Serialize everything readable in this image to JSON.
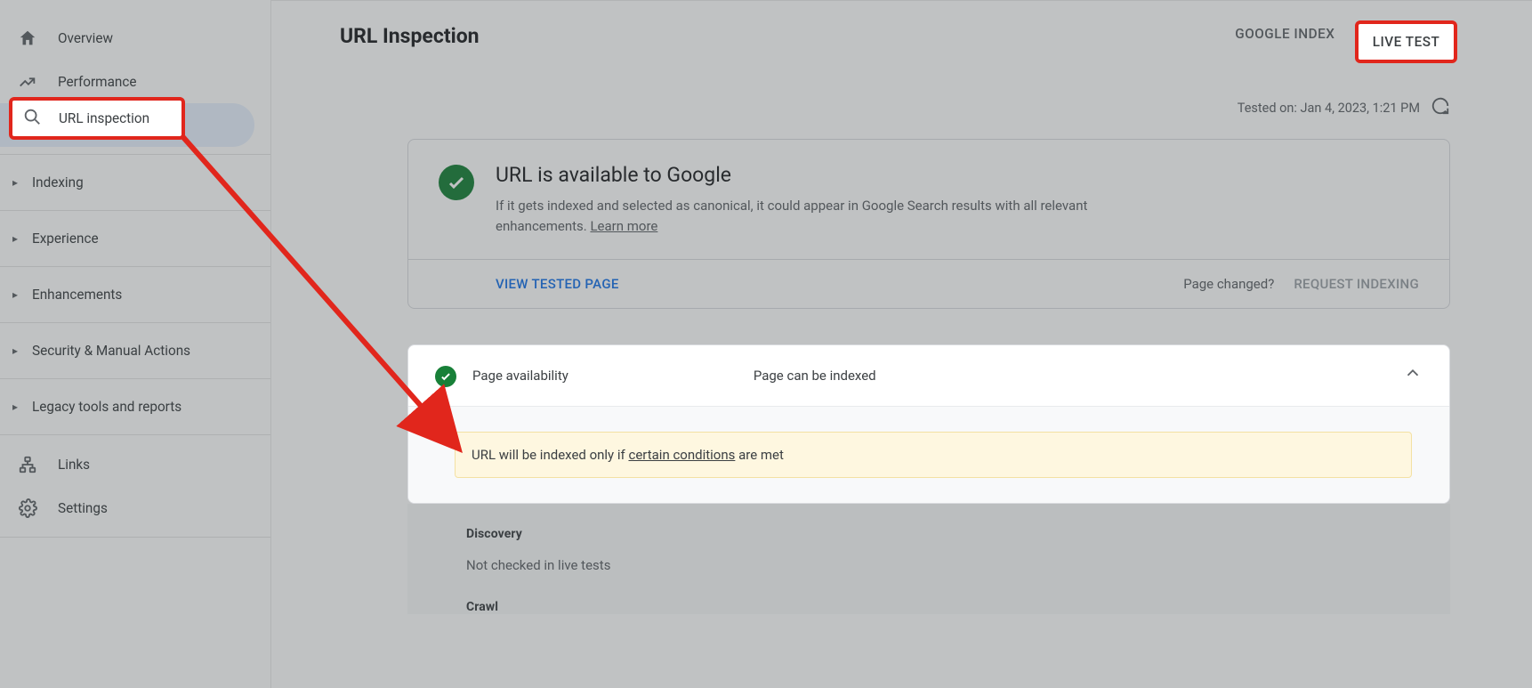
{
  "sidebar": {
    "overview": "Overview",
    "performance": "Performance",
    "url_inspection": "URL inspection",
    "indexing": "Indexing",
    "experience": "Experience",
    "enhancements": "Enhancements",
    "security": "Security & Manual Actions",
    "legacy": "Legacy tools and reports",
    "links": "Links",
    "settings": "Settings"
  },
  "header": {
    "title": "URL Inspection",
    "tab_google_index": "GOOGLE INDEX",
    "tab_live_test": "LIVE TEST"
  },
  "tested_on": {
    "prefix": "Tested on: ",
    "value": "Jan 4, 2023, 1:21 PM"
  },
  "status": {
    "title": "URL is available to Google",
    "desc_before": "If it gets indexed and selected as canonical, it could appear in Google Search results with all relevant enhancements. ",
    "learn_more": "Learn more"
  },
  "actions": {
    "view_tested": "VIEW TESTED PAGE",
    "page_changed": "Page changed?",
    "request_indexing": "REQUEST INDEXING"
  },
  "availability": {
    "section": "Page availability",
    "state": "Page can be indexed",
    "notice_before": "URL will be indexed only if ",
    "notice_link": "certain conditions",
    "notice_after": " are met"
  },
  "discovery": {
    "heading": "Discovery",
    "value": "Not checked in live tests"
  },
  "crawl": {
    "heading": "Crawl"
  }
}
